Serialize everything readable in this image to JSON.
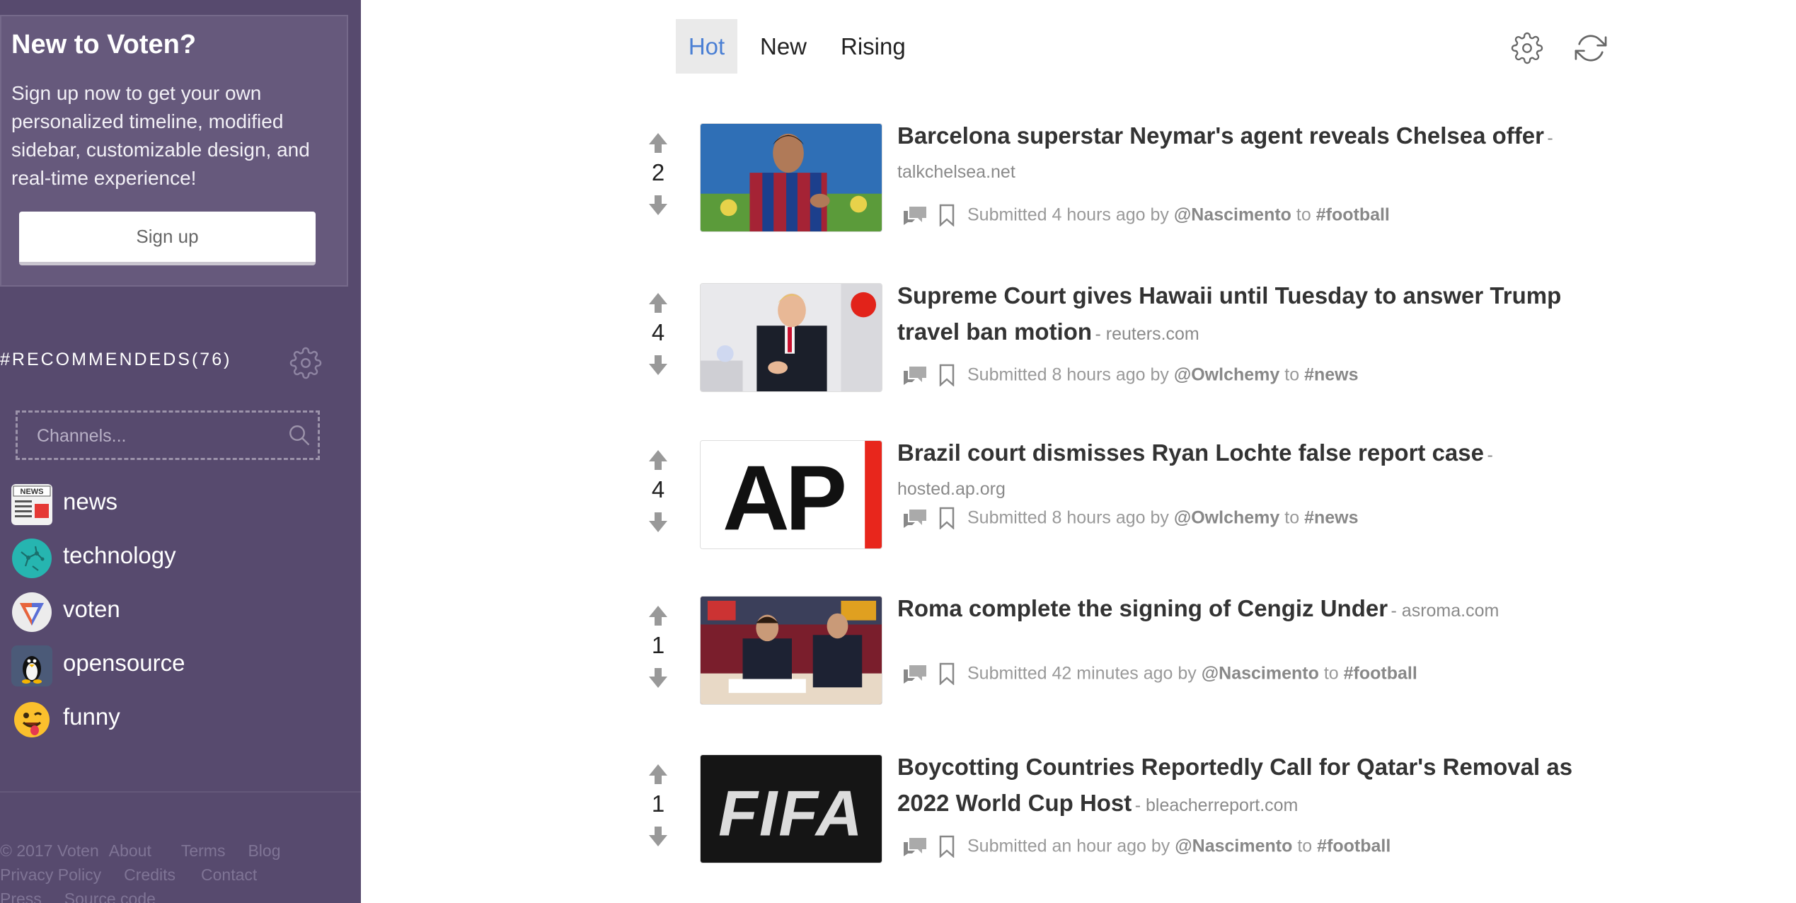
{
  "sidebar": {
    "signup": {
      "title": "New to Voten?",
      "text": "Sign up now to get your own personalized timeline, modified sidebar, customizable design, and real-time experience!",
      "button_label": "Sign up"
    },
    "recommended_header": "#RECOMMENDEDS(76)",
    "search_placeholder": "Channels...",
    "channels": [
      {
        "label": "news",
        "icon": "news-icon"
      },
      {
        "label": "technology",
        "icon": "technology-icon"
      },
      {
        "label": "voten",
        "icon": "voten-icon"
      },
      {
        "label": "opensource",
        "icon": "penguin-icon"
      },
      {
        "label": "funny",
        "icon": "emoji-icon"
      }
    ],
    "footer": {
      "copyright": "© 2017 Voten",
      "about": "About",
      "terms": "Terms",
      "blog": "Blog",
      "privacy": "Privacy Policy",
      "credits": "Credits",
      "contact": "Contact",
      "press": "Press",
      "source": "Source code"
    }
  },
  "tabs": [
    {
      "label": "Hot",
      "active": true
    },
    {
      "label": "New",
      "active": false
    },
    {
      "label": "Rising",
      "active": false
    }
  ],
  "icons": {
    "settings": "gear-icon",
    "refresh": "refresh-icon"
  },
  "colors": {
    "sidebar_bg": "#574a6e",
    "active_tab": "#4a7fd4"
  },
  "posts": [
    {
      "votes": "2",
      "title": "Barcelona superstar Neymar's agent reveals Chelsea offer",
      "domain": "- talkchelsea.net",
      "submitted": "Submitted 4 hours ago by",
      "user": "@Nascimento",
      "to": "to",
      "channel": "#football"
    },
    {
      "votes": "4",
      "title": "Supreme Court gives Hawaii until Tuesday to answer Trump travel ban motion",
      "domain": "- reuters.com",
      "submitted": "Submitted 8 hours ago by",
      "user": "@Owlchemy",
      "to": "to",
      "channel": "#news"
    },
    {
      "votes": "4",
      "title": "Brazil court dismisses Ryan Lochte false report case",
      "domain": "- hosted.ap.org",
      "submitted": "Submitted 8 hours ago by",
      "user": "@Owlchemy",
      "to": "to",
      "channel": "#news",
      "thumb_text": "AP"
    },
    {
      "votes": "1",
      "title": "Roma complete the signing of Cengiz Under",
      "domain": "- asroma.com",
      "submitted": "Submitted 42 minutes ago by",
      "user": "@Nascimento",
      "to": "to",
      "channel": "#football"
    },
    {
      "votes": "1",
      "title": "Boycotting Countries Reportedly Call for Qatar's Removal as 2022 World Cup Host",
      "domain": "- bleacherreport.com",
      "submitted": "Submitted an hour ago by",
      "user": "@Nascimento",
      "to": "to",
      "channel": "#football",
      "thumb_text": "FIFA"
    }
  ]
}
